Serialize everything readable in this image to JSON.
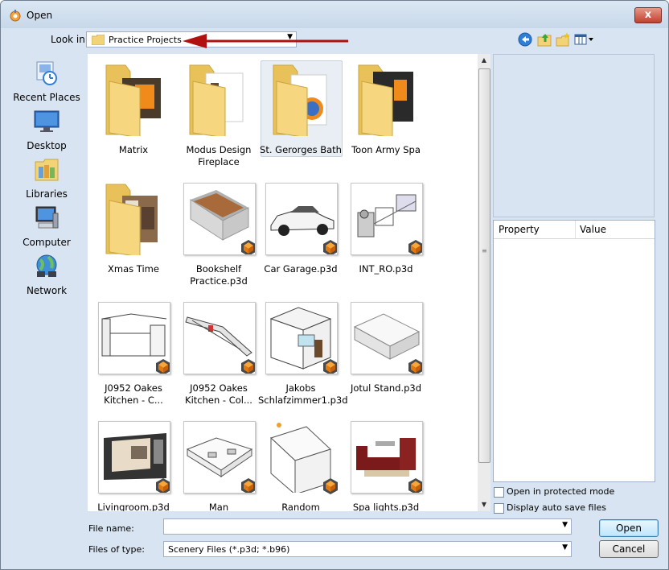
{
  "window": {
    "title": "Open",
    "close_label": "x"
  },
  "lookin": {
    "label": "Look in:",
    "value": "Practice Projects"
  },
  "toolbar": {
    "icons": [
      "back-icon",
      "up-folder-icon",
      "new-folder-icon",
      "views-menu-icon"
    ]
  },
  "places": [
    {
      "label": "Recent Places",
      "icon": "recent-places-icon"
    },
    {
      "label": "Desktop",
      "icon": "desktop-icon"
    },
    {
      "label": "Libraries",
      "icon": "libraries-icon"
    },
    {
      "label": "Computer",
      "icon": "computer-icon"
    },
    {
      "label": "Network",
      "icon": "network-icon"
    }
  ],
  "files": [
    {
      "name": "Matrix",
      "kind": "folder"
    },
    {
      "name": "Modus Design Fireplace",
      "kind": "folder"
    },
    {
      "name": "St. Gerorges Bath",
      "kind": "folder",
      "selected": true
    },
    {
      "name": "Toon Army Spa",
      "kind": "folder"
    },
    {
      "name": "Xmas Time",
      "kind": "folder"
    },
    {
      "name": "Bookshelf Practice.p3d",
      "kind": "p3d"
    },
    {
      "name": "Car Garage.p3d",
      "kind": "p3d"
    },
    {
      "name": "INT_RO.p3d",
      "kind": "p3d"
    },
    {
      "name": "J0952 Oakes Kitchen - C...",
      "kind": "p3d"
    },
    {
      "name": "J0952 Oakes Kitchen - Col...",
      "kind": "p3d"
    },
    {
      "name": "Jakobs Schlafzimmer1.p3d",
      "kind": "p3d"
    },
    {
      "name": "Jotul Stand.p3d",
      "kind": "p3d"
    },
    {
      "name": "Livingroom.p3d",
      "kind": "p3d"
    },
    {
      "name": "Man",
      "kind": "p3d"
    },
    {
      "name": "Random",
      "kind": "p3d"
    },
    {
      "name": "Spa lights.p3d",
      "kind": "p3d"
    }
  ],
  "properties": {
    "col_property": "Property",
    "col_value": "Value"
  },
  "options": {
    "protected_mode": "Open in protected mode",
    "auto_save": "Display auto save files"
  },
  "filename": {
    "label": "File name:",
    "value": ""
  },
  "filetype": {
    "label": "Files of type:",
    "value": "Scenery Files (*.p3d; *.b96)"
  },
  "buttons": {
    "open": "Open",
    "cancel": "Cancel"
  },
  "colors": {
    "accent_arrow": "#b01010",
    "folder": "#f3d378",
    "badge": "#e58a1f"
  }
}
